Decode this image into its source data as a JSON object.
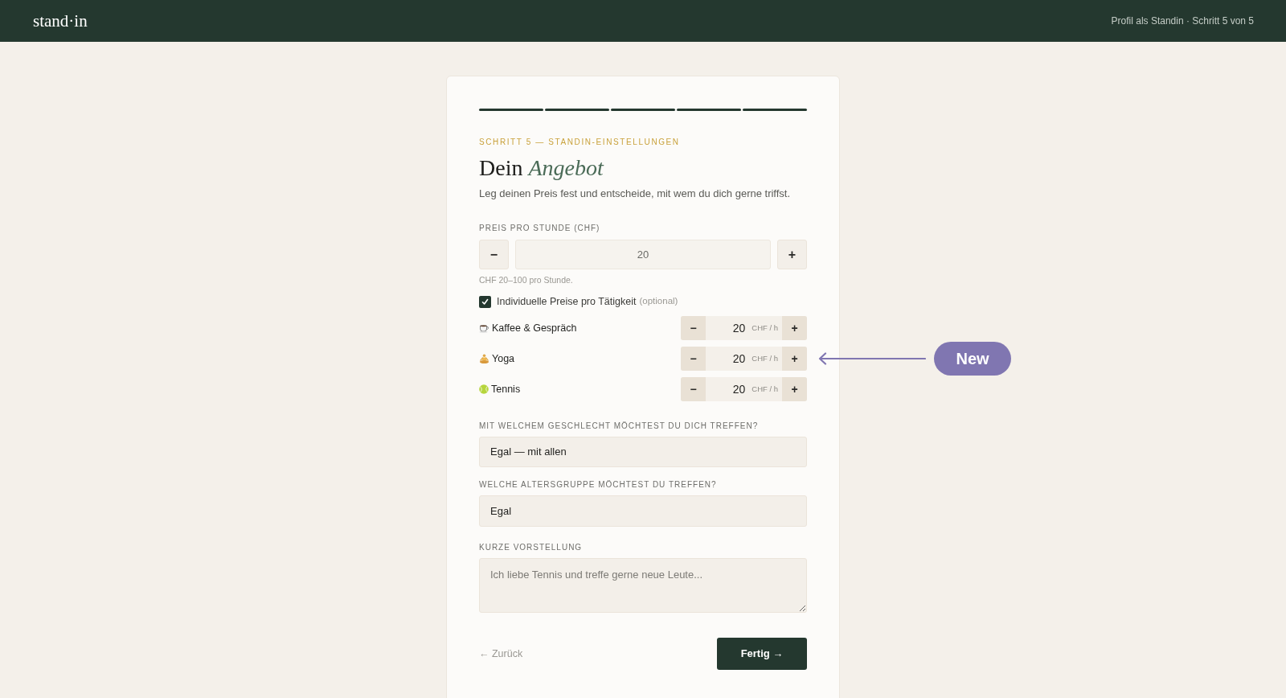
{
  "header": {
    "logo": "stand·in",
    "progress_text": "Profil als Standin · Schritt 5 von 5"
  },
  "card": {
    "progress": [
      {
        "done": true
      },
      {
        "done": true
      },
      {
        "done": true
      },
      {
        "done": true
      },
      {
        "done": true
      }
    ],
    "eyebrow": "SCHRITT 5 — STANDIN-EINSTELLUNGEN",
    "title": "Dein *Angebot*",
    "subtitle": "Leg deinen Preis fest und entscheide, mit wem du dich gerne triffst.",
    "price": {
      "label": "PREIS PRO STUNDE (CHF)",
      "minus": "−",
      "value": "20",
      "plus": "+",
      "hint": "CHF 20–100 pro Stunde."
    },
    "individual_prices": {
      "label": "Individuelle Preise pro Tätigkeit",
      "note": "(optional)",
      "checked": true
    },
    "activities": [
      {
        "kind": "coffee",
        "name": "Kaffee & Gespräch",
        "minus": "−",
        "value": "20",
        "unit": "CHF / h",
        "plus": "+"
      },
      {
        "kind": "yoga",
        "name": "Yoga",
        "minus": "−",
        "value": "20",
        "unit": "CHF / h",
        "plus": "+"
      },
      {
        "kind": "tennis",
        "name": "Tennis",
        "minus": "−",
        "value": "20",
        "unit": "CHF / h",
        "plus": "+"
      }
    ],
    "gender": {
      "label": "MIT WELCHEM GESCHLECHT MÖCHTEST DU DICH TREFFEN?",
      "value": "Egal — mit allen"
    },
    "age": {
      "label": "WELCHE ALTERSGRUPPE MÖCHTEST DU TREFFEN?",
      "value": "Egal"
    },
    "intro": {
      "label": "KURZE VORSTELLUNG",
      "placeholder": "Ich liebe Tennis und treffe gerne neue Leute..."
    },
    "back": "← Zurück",
    "submit": "Fertig →"
  },
  "annotation": {
    "label": "New"
  }
}
